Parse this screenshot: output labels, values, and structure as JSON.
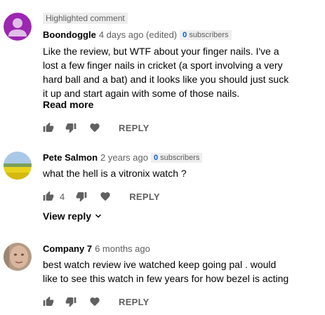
{
  "comments": [
    {
      "highlight_label": "Highlighted comment",
      "author": "Boondoggle",
      "time": "4 days ago (edited)",
      "subscribers_count": "0",
      "subscribers_label": "subscribers",
      "text": "Like the review, but WTF about your finger nails. I've a\nlost a few finger nails in cricket (a sport involving a very\nhard ball and a bat) and it looks like you should just suck\nit up and start again with some of those nails.",
      "read_more": "Read more",
      "reply_label": "REPLY",
      "avatar": "default-person-avatar",
      "avatar_color": "#9c27b0"
    },
    {
      "author": "Pete Salmon",
      "time": "2 years ago",
      "subscribers_count": "0",
      "subscribers_label": "subscribers",
      "text": "what the hell is a vitronix watch ?",
      "like_count": "4",
      "reply_label": "REPLY",
      "view_reply": "View reply",
      "avatar": "yellow-field-photo"
    },
    {
      "author": "Company 7",
      "time": "6 months ago",
      "text": "best watch review ive watched keep going pal . would\nlike to see this watch in few years for how bezel is acting",
      "reply_label": "REPLY",
      "avatar": "face-photo"
    }
  ],
  "icons": {
    "like": "thumbs-up-icon",
    "dislike": "thumbs-down-icon",
    "heart": "heart-icon",
    "chevron": "chevron-down-icon"
  },
  "colors": {
    "link_blue": "#065fd4",
    "secondary_text": "#606060",
    "badge_bg": "#eeeeee"
  }
}
